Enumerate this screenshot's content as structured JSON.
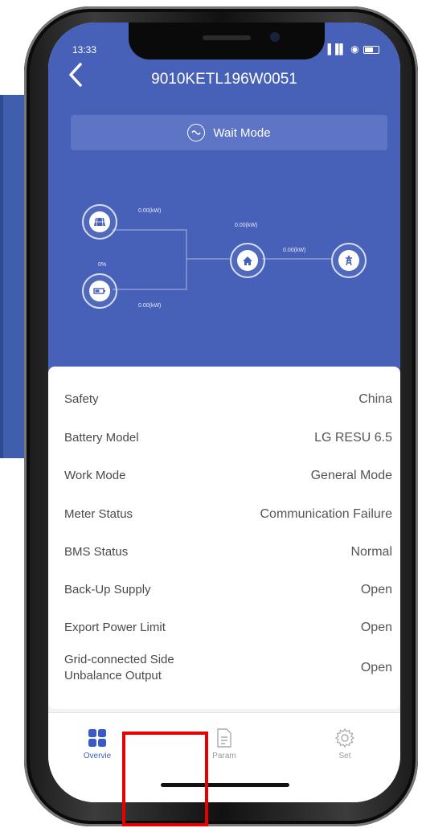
{
  "status_bar": {
    "time": "13:33",
    "signal": "▐▐▌",
    "wifi": "◉"
  },
  "header": {
    "title": "9010KETL196W0051",
    "back_icon": "chevron-left-icon"
  },
  "mode": {
    "label": "Wait Mode",
    "icon": "wave-circle-icon"
  },
  "flow": {
    "pv_power": "0.00(kW)",
    "battery_soc": "0%",
    "battery_power": "0.00(kW)",
    "load_power": "0.00(kW)",
    "grid_power": "0.00(kW)",
    "icons": [
      "solar-panel-icon",
      "battery-icon",
      "house-icon",
      "grid-tower-icon"
    ]
  },
  "info_rows": [
    {
      "label": "Safety",
      "value": "China"
    },
    {
      "label": "Battery Model",
      "value": "LG RESU 6.5"
    },
    {
      "label": "Work Mode",
      "value": "General Mode"
    },
    {
      "label": "Meter Status",
      "value": "Communication Failure"
    },
    {
      "label": "BMS Status",
      "value": "Normal"
    },
    {
      "label": "Back-Up Supply",
      "value": "Open"
    },
    {
      "label": "Export Power Limit",
      "value": "Open"
    },
    {
      "label": "Grid-connected Side\nUnbalance Output",
      "value": "Open"
    }
  ],
  "tabs": [
    {
      "label": "Overvie",
      "icon": "grid-icon",
      "active": true
    },
    {
      "label": "Param",
      "icon": "document-icon",
      "active": false
    },
    {
      "label": "Set",
      "icon": "gear-icon",
      "active": false
    }
  ],
  "colors": {
    "primary": "#4761b8",
    "active_tab": "#3a5bc7",
    "highlight_box": "#e60000"
  }
}
